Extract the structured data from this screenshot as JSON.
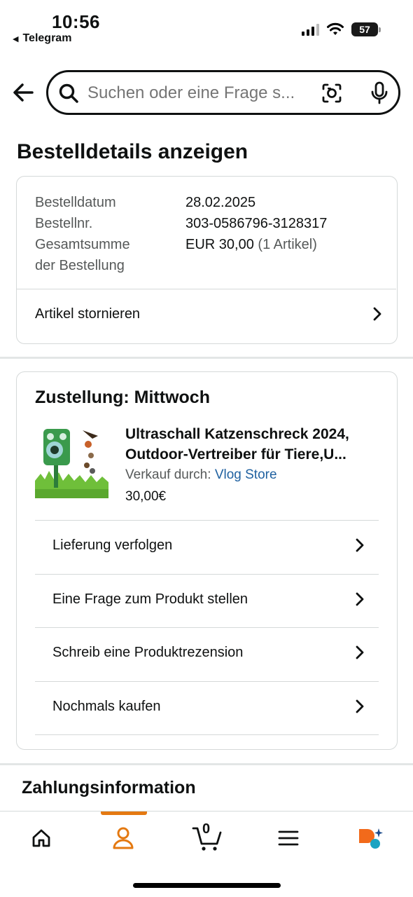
{
  "status_bar": {
    "time": "10:56",
    "back_app": "Telegram",
    "battery": "57"
  },
  "search": {
    "placeholder": "Suchen oder eine Frage s..."
  },
  "page": {
    "title": "Bestelldetails anzeigen"
  },
  "order": {
    "date_label": "Bestelldatum",
    "date_value": "28.02.2025",
    "number_label": "Bestellnr.",
    "number_value": "303-0586796-3128317",
    "total_label_line1": "Gesamtsumme",
    "total_label_line2": "der Bestellung",
    "total_value": "EUR 30,00",
    "total_items": "(1 Artikel)",
    "cancel_label": "Artikel stornieren"
  },
  "delivery": {
    "title": "Zustellung: Mittwoch",
    "product": {
      "title_line1": "Ultraschall Katzenschreck 2024,",
      "title_line2": "Outdoor-Vertreiber für Tiere,U...",
      "seller_prefix": "Verkauf durch:",
      "seller_name": "Vlog Store",
      "price": "30,00€"
    },
    "actions": [
      {
        "label": "Lieferung verfolgen"
      },
      {
        "label": "Eine Frage zum Produkt stellen"
      },
      {
        "label": "Schreib eine Produktrezension"
      },
      {
        "label": "Nochmals kaufen"
      }
    ]
  },
  "payment": {
    "title": "Zahlungsinformation"
  },
  "nav": {
    "cart_count": "0",
    "active": "account"
  },
  "colors": {
    "accent": "#e47911",
    "link": "#2162a1",
    "border": "#d5d9d9"
  }
}
